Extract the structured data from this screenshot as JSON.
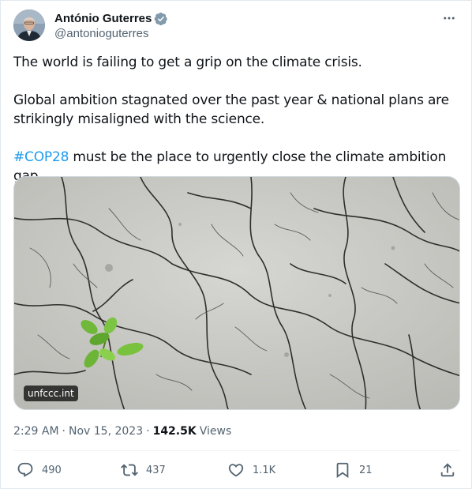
{
  "author": {
    "display_name": "António Guterres",
    "handle": "@antonioguterres",
    "verified": true,
    "verified_color": "#829aab"
  },
  "more_icon": "more-horizontal-icon",
  "tweet": {
    "line1": "The world is failing to get a grip on the climate crisis.",
    "line2": "Global ambition stagnated over the past year & national plans are strikingly misaligned with the science.",
    "hashtag": "#COP28",
    "line3_rest": " must be the place to urgently close the climate ambition gap."
  },
  "media": {
    "badge": "unfccc.int"
  },
  "meta": {
    "time": "2:29 AM",
    "separator": "·",
    "date": "Nov 15, 2023",
    "separator2": "·",
    "views_count": "142.5K",
    "views_label": "Views"
  },
  "actions": {
    "replies": "490",
    "retweets": "437",
    "likes": "1.1K",
    "bookmarks": "21"
  },
  "colors": {
    "link": "#1d9bf0",
    "text": "#0f1419",
    "secondary": "#536471"
  }
}
